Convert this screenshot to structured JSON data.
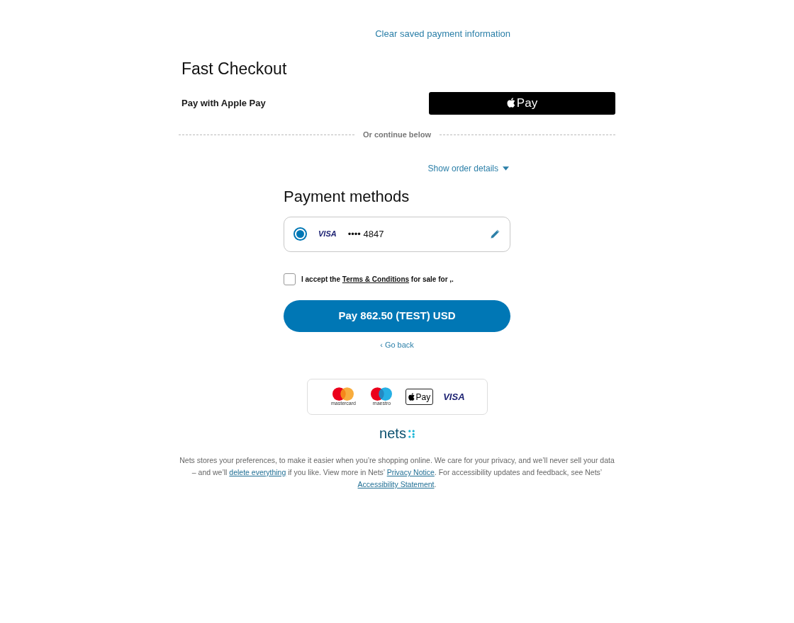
{
  "clear_link": "Clear saved payment information",
  "fast_checkout": {
    "title": "Fast Checkout",
    "label": "Pay with Apple Pay",
    "button_text": "Pay"
  },
  "divider_text": "Or continue below",
  "order_details": {
    "label": "Show order details",
    "expanded": false
  },
  "payment_methods": {
    "title": "Payment methods",
    "cards": [
      {
        "brand": "VISA",
        "number": "•••• 4847",
        "selected": true
      }
    ]
  },
  "terms": {
    "checked": false,
    "before": "I accept the ",
    "link": "Terms & Conditions",
    "after": " for sale for ,."
  },
  "pay_button": "Pay 862.50 (TEST) USD",
  "go_back": "‹ Go back",
  "accepted_cards": [
    {
      "kind": "mastercard",
      "caption": "mastercard"
    },
    {
      "kind": "maestro",
      "caption": "maestro"
    },
    {
      "kind": "applepay",
      "caption": "Pay"
    },
    {
      "kind": "visa",
      "caption": "VISA"
    }
  ],
  "brand": "nets",
  "footer": [
    {
      "text": "Nets stores your preferences, to make it easier when you’re shopping online. We care for your privacy, and we’ll never sell your data – and we’ll ",
      "kind": "text"
    },
    {
      "text": "delete everything",
      "kind": "link"
    },
    {
      "text": " if you like. View more in Nets’ ",
      "kind": "text"
    },
    {
      "text": "Privacy Notice",
      "kind": "link"
    },
    {
      "text": ". For accessibility updates and feedback, see Nets’ ",
      "kind": "text"
    },
    {
      "text": "Accessibility Statement",
      "kind": "link"
    },
    {
      "text": ".",
      "kind": "text"
    }
  ]
}
